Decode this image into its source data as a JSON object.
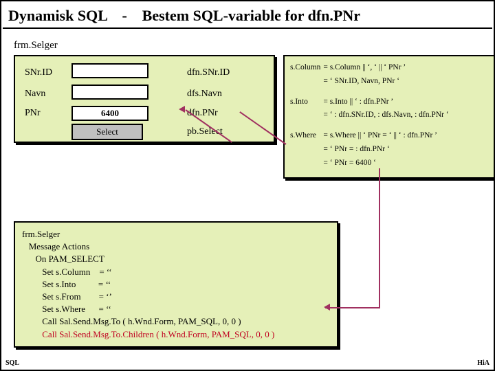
{
  "title": {
    "left": "Dynamisk SQL",
    "right": "Bestem SQL-variable for dfn.PNr",
    "dash": "-"
  },
  "frm": {
    "name": "frm.Selger",
    "rows": [
      {
        "label": "SNr.ID",
        "value": "",
        "df": "dfn.SNr.ID"
      },
      {
        "label": "Navn",
        "value": "",
        "df": "dfs.Navn"
      },
      {
        "label": "PNr",
        "value": "6400",
        "df": "dfn.PNr"
      }
    ],
    "button": "Select",
    "button_df": "pb.Select"
  },
  "sql": {
    "col_k": "s.Column",
    "col_v1": "= s.Column || ‘, ‘ || ‘ PNr ’",
    "col_v2": "= ‘ SNr.ID, Navn, PNr ‘",
    "into_k": "s.Into",
    "into_v1": "= s.Into || ‘ : dfn.PNr ’",
    "into_v2": "= ‘ : dfn.SNr.ID, : dfs.Navn, : dfn.PNr ‘",
    "where_k": "s.Where",
    "where_v1": "= s.Where || ‘ PNr = ‘ || ‘ : dfn.PNr ’",
    "where_v2": "= ‘ PNr = : dfn.PNr ‘",
    "where_v3": "= ‘ PNr = 6400 ‘"
  },
  "code": {
    "l1": "frm.Selger",
    "l2": "   Message Actions",
    "l3": "      On PAM_SELECT",
    "l4": "         Set s.Column    = ‘‘",
    "l5": "         Set s.Into          = ‘‘",
    "l6": "         Set s.From        = ‘’",
    "l7": "         Set s.Where      = ‘‘",
    "l8": "         Call Sal.Send.Msg.To ( h.Wnd.Form, PAM_SQL, 0, 0 )",
    "l9": "         Call Sal.Send.Msg.To.Children ( h.Wnd.Form, PAM_SQL, 0, 0 )",
    "l10": "         . . ."
  },
  "footer": {
    "left": "SQL",
    "right": "HiA"
  }
}
